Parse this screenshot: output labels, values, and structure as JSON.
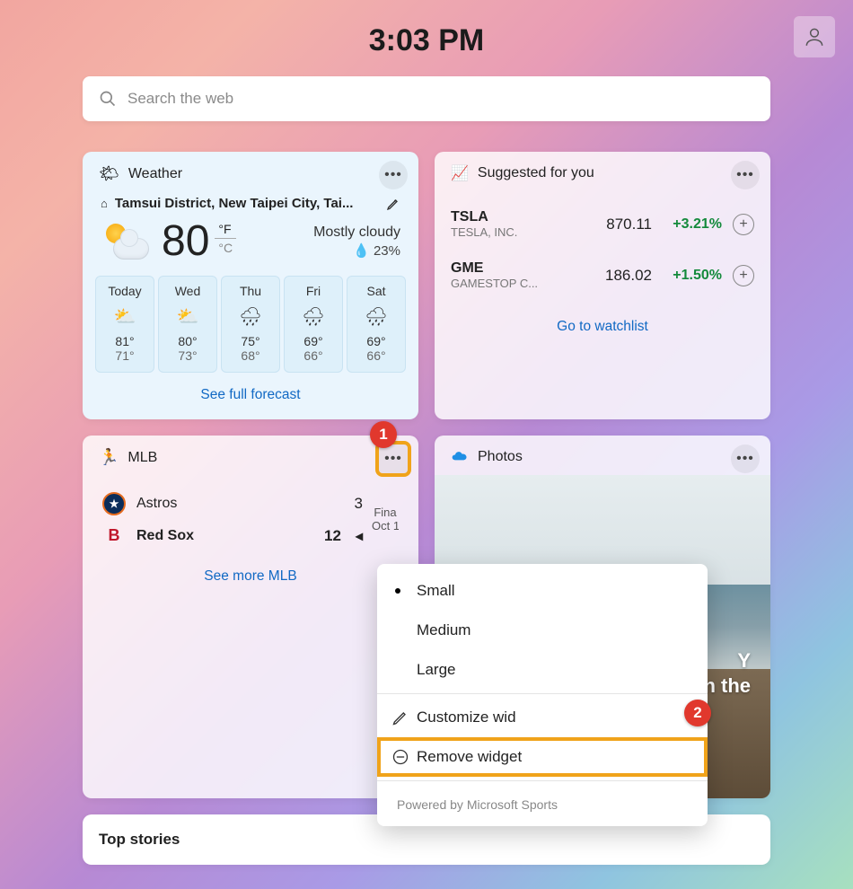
{
  "clock": "3:03 PM",
  "search": {
    "placeholder": "Search the web"
  },
  "weather": {
    "title": "Weather",
    "location": "Tamsui District, New Taipei City, Tai...",
    "temp": "80",
    "unit_f": "°F",
    "unit_c": "°C",
    "condition": "Mostly cloudy",
    "humidity": "23%",
    "forecast": [
      {
        "day": "Today",
        "hi": "81°",
        "lo": "71°",
        "icon": "⛅"
      },
      {
        "day": "Wed",
        "hi": "80°",
        "lo": "73°",
        "icon": "⛅"
      },
      {
        "day": "Thu",
        "hi": "75°",
        "lo": "68°",
        "icon": "🌧"
      },
      {
        "day": "Fri",
        "hi": "69°",
        "lo": "66°",
        "icon": "🌧"
      },
      {
        "day": "Sat",
        "hi": "69°",
        "lo": "66°",
        "icon": "🌧"
      }
    ],
    "link": "See full forecast"
  },
  "stocks": {
    "title": "Suggested for you",
    "rows": [
      {
        "sym": "TSLA",
        "co": "TESLA, INC.",
        "price": "870.11",
        "chg": "+3.21%"
      },
      {
        "sym": "GME",
        "co": "GAMESTOP C...",
        "price": "186.02",
        "chg": "+1.50%"
      }
    ],
    "link": "Go to watchlist"
  },
  "mlb": {
    "title": "MLB",
    "away": {
      "name": "Astros",
      "score": "3"
    },
    "home": {
      "name": "Red Sox",
      "score": "12"
    },
    "status_line1": "Fina",
    "status_line2": "Oct 1",
    "link": "See more MLB"
  },
  "photos": {
    "title": "Photos",
    "tag_l1": "Y",
    "tag_l2": "n the"
  },
  "context_menu": {
    "small": "Small",
    "medium": "Medium",
    "large": "Large",
    "customize": "Customize wid",
    "remove": "Remove widget",
    "footer": "Powered by Microsoft Sports"
  },
  "callouts": {
    "c1": "1",
    "c2": "2"
  },
  "topstories": {
    "title": "Top stories"
  }
}
